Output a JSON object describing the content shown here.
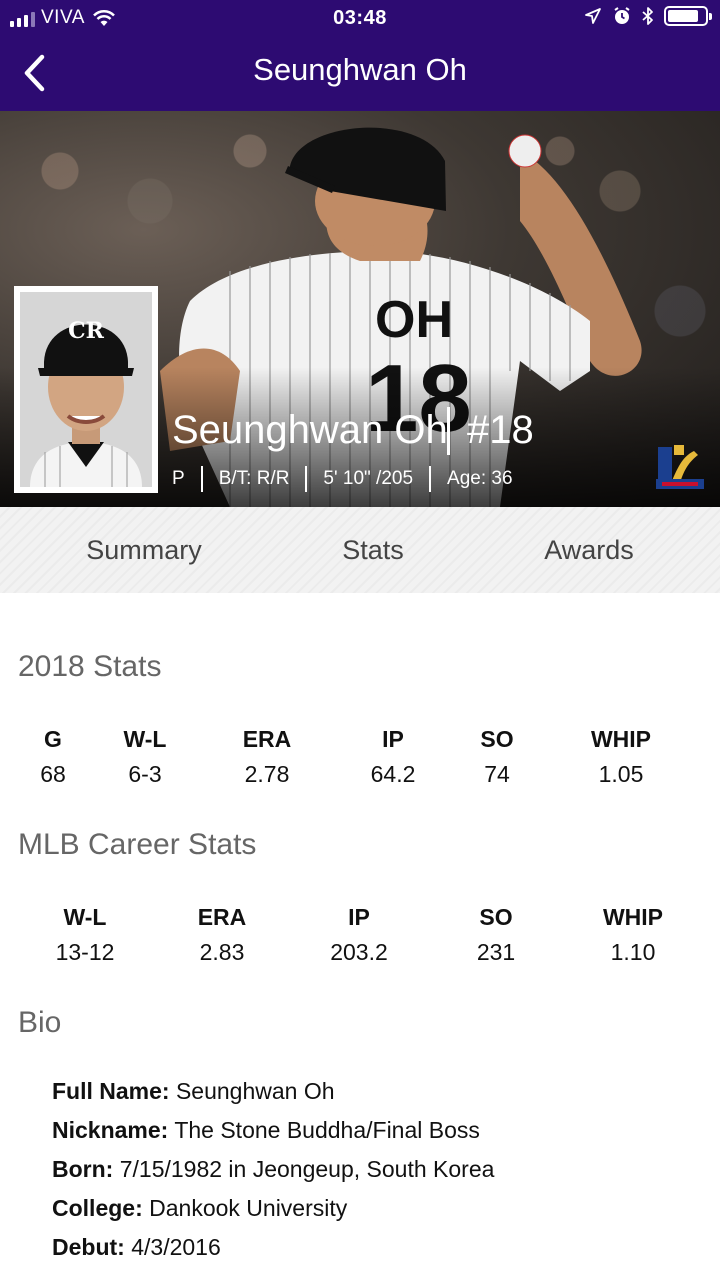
{
  "status_bar": {
    "carrier": "VIVA",
    "time": "03:48",
    "icons": [
      "signal-icon",
      "wifi-icon",
      "location-icon",
      "alarm-icon",
      "bluetooth-icon",
      "battery-icon"
    ]
  },
  "nav": {
    "title": "Seunghwan Oh",
    "back_icon": "chevron-left-icon"
  },
  "hero": {
    "name": "Seunghwan Oh",
    "number": "#18",
    "position": "P",
    "bats_throws": "B/T: R/R",
    "height_weight": "5' 10\" /205",
    "age": "Age: 36",
    "headshot_cap_logo": "CR"
  },
  "tabs": [
    {
      "label": "Summary"
    },
    {
      "label": "Stats"
    },
    {
      "label": "Awards"
    }
  ],
  "season_stats": {
    "title": "2018 Stats",
    "columns": [
      {
        "header": "G",
        "value": "68"
      },
      {
        "header": "W-L",
        "value": "6-3"
      },
      {
        "header": "ERA",
        "value": "2.78"
      },
      {
        "header": "IP",
        "value": "64.2"
      },
      {
        "header": "SO",
        "value": "74"
      },
      {
        "header": "WHIP",
        "value": "1.05"
      }
    ]
  },
  "career_stats": {
    "title": "MLB Career Stats",
    "columns": [
      {
        "header": "W-L",
        "value": "13-12"
      },
      {
        "header": "ERA",
        "value": "2.83"
      },
      {
        "header": "IP",
        "value": "203.2"
      },
      {
        "header": "SO",
        "value": "231"
      },
      {
        "header": "WHIP",
        "value": "1.10"
      }
    ]
  },
  "bio": {
    "title": "Bio",
    "rows": [
      {
        "label": "Full Name:",
        "value": "Seunghwan Oh"
      },
      {
        "label": "Nickname:",
        "value": "The Stone Buddha/Final Boss"
      },
      {
        "label": "Born:",
        "value": "7/15/1982 in Jeongeup, South Korea"
      },
      {
        "label": "College:",
        "value": "Dankook University"
      },
      {
        "label": "Debut:",
        "value": "4/3/2016"
      }
    ]
  },
  "colors": {
    "nav_bg": "#2d0b72",
    "section_title": "#666666"
  }
}
